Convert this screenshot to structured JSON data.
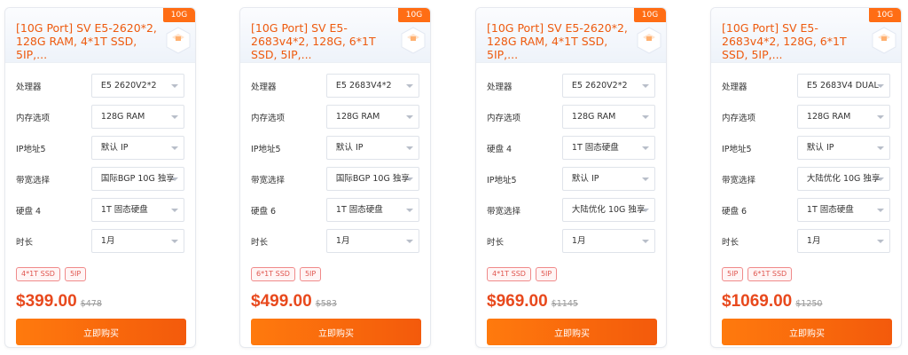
{
  "products": [
    {
      "title": "[10G Port] SV E5-2620*2, 128G RAM, 4*1T SSD, 5IP,...",
      "tag": "10G",
      "options": [
        {
          "label": "处理器",
          "value": "E5 2620V2*2"
        },
        {
          "label": "内存选项",
          "value": "128G RAM"
        },
        {
          "label": "IP地址5",
          "value": "默认 IP"
        },
        {
          "label": "带宽选择",
          "value": "国际BGP 10G 独享"
        },
        {
          "label": "硬盘 4",
          "value": "1T 固态硬盘"
        },
        {
          "label": "时长",
          "value": "1月"
        }
      ],
      "badges": [
        "4*1T SSD",
        "5IP"
      ],
      "price": "$399.00",
      "old_price": "$478",
      "buy_label": "立即购买"
    },
    {
      "title": "[10G Port] SV E5-2683v4*2, 128G, 6*1T SSD, 5IP,...",
      "tag": "10G",
      "options": [
        {
          "label": "处理器",
          "value": "E5 2683V4*2"
        },
        {
          "label": "内存选项",
          "value": "128G RAM"
        },
        {
          "label": "IP地址5",
          "value": "默认 IP"
        },
        {
          "label": "带宽选择",
          "value": "国际BGP 10G 独享"
        },
        {
          "label": "硬盘 6",
          "value": "1T 固态硬盘"
        },
        {
          "label": "时长",
          "value": "1月"
        }
      ],
      "badges": [
        "6*1T SSD",
        "5IP"
      ],
      "price": "$499.00",
      "old_price": "$583",
      "buy_label": "立即购买"
    },
    {
      "title": "[10G Port] SV E5-2620*2, 128G RAM, 4*1T SSD, 5IP,...",
      "tag": "10G",
      "options": [
        {
          "label": "处理器",
          "value": "E5 2620V2*2"
        },
        {
          "label": "内存选项",
          "value": "128G RAM"
        },
        {
          "label": "硬盘 4",
          "value": "1T 固态硬盘"
        },
        {
          "label": "IP地址5",
          "value": "默认 IP"
        },
        {
          "label": "带宽选择",
          "value": "大陆优化 10G 独享"
        },
        {
          "label": "时长",
          "value": "1月"
        }
      ],
      "badges": [
        "4*1T SSD",
        "5IP"
      ],
      "price": "$969.00",
      "old_price": "$1145",
      "buy_label": "立即购买"
    },
    {
      "title": "[10G Port] SV E5-2683v4*2, 128G, 6*1T SSD, 5IP,...",
      "tag": "10G",
      "options": [
        {
          "label": "处理器",
          "value": "E5 2683V4 DUAL"
        },
        {
          "label": "内存选项",
          "value": "128G RAM"
        },
        {
          "label": "IP地址5",
          "value": "默认 IP"
        },
        {
          "label": "带宽选择",
          "value": "大陆优化 10G 独享"
        },
        {
          "label": "硬盘 6",
          "value": "1T 固态硬盘"
        },
        {
          "label": "时长",
          "value": "1月"
        }
      ],
      "badges": [
        "5IP",
        "6*1T SSD"
      ],
      "price": "$1069.00",
      "old_price": "$1250",
      "buy_label": "立即购买"
    }
  ],
  "colors": {
    "accent": "#ff6d14",
    "price": "#e8491d",
    "title": "#ee5a0e"
  }
}
